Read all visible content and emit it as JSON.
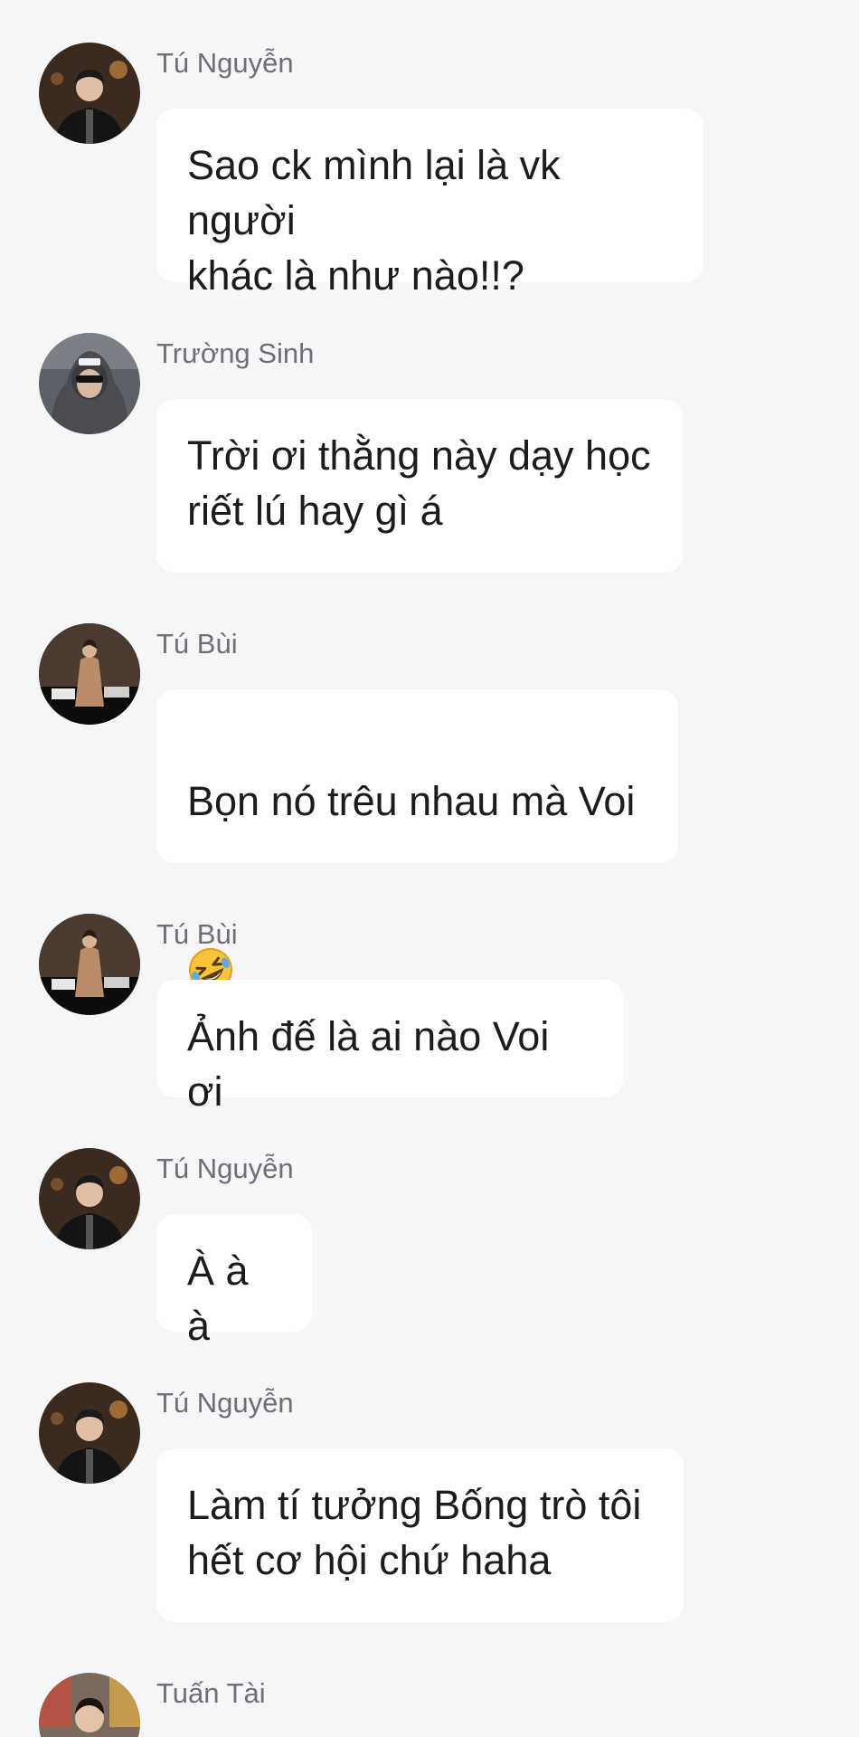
{
  "messages": [
    {
      "sender": "Tú Nguyễn",
      "text": "Sao ck mình lại là vk người\nkhác là như nào!!?",
      "avatar_icon": "man-in-black-shirt-avatar-icon"
    },
    {
      "sender": "Trường Sinh",
      "text": "Trời ơi thằng này dạy học\nriết lú hay gì á",
      "avatar_icon": "man-in-hood-sunglasses-avatar-icon"
    },
    {
      "sender": "Tú Bùi",
      "text": "Bọn nó trêu nhau mà Voi",
      "emoji": "rolling-on-floor-laughing-emoji",
      "avatar_icon": "person-in-coat-avatar-icon"
    },
    {
      "sender": "Tú Bùi",
      "text": "Ảnh đế là ai nào Voi ơi",
      "avatar_icon": "person-in-coat-avatar-icon"
    },
    {
      "sender": "Tú Nguyễn",
      "text": "À à à",
      "avatar_icon": "man-in-black-shirt-avatar-icon"
    },
    {
      "sender": "Tú Nguyễn",
      "text": "Làm tí tưởng Bống trò tôi\nhết cơ hội chứ haha",
      "avatar_icon": "man-in-black-shirt-avatar-icon"
    },
    {
      "sender": "Tuấn Tài",
      "avatar_icon": "man-street-avatar-icon"
    }
  ],
  "colors": {
    "background": "#f4f6f8",
    "bubble": "#ffffff",
    "sender_text": "#6e6e73",
    "message_text": "#1c1c1e"
  }
}
